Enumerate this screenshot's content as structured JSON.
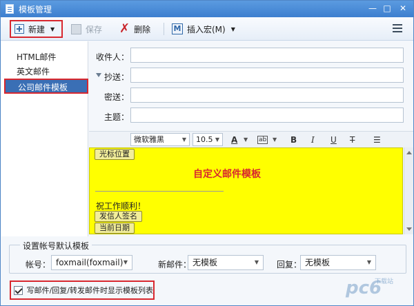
{
  "window": {
    "title": "模板管理",
    "min": "—",
    "max": "□",
    "close": "✕"
  },
  "toolbar": {
    "new_label": "新建",
    "save_label": "保存",
    "delete_label": "删除",
    "macro_label": "插入宏(M)",
    "macro_icon_letter": "M",
    "delete_icon_glyph": "✗"
  },
  "sidebar": {
    "items": [
      {
        "label": "HTML邮件"
      },
      {
        "label": "英文邮件"
      },
      {
        "label": "公司邮件模板"
      }
    ]
  },
  "form": {
    "to_label": "收件人：",
    "cc_label": "抄送：",
    "bcc_label": "密送：",
    "subject_label": "主题："
  },
  "format": {
    "font": "微软雅黑",
    "size": "10.5",
    "font_color": "A",
    "highlight": "ab",
    "bold": "B",
    "italic": "I",
    "underline": "U",
    "strike": "T",
    "list": "☰"
  },
  "editor": {
    "cursor_chip": "光标位置",
    "title": "自定义邮件模板",
    "greeting": "祝工作顺利！",
    "sender_chip": "发信人签名",
    "date_chip": "当前日期",
    "background_color": "#ffff00",
    "title_color": "#d8272e"
  },
  "defaults": {
    "group_title": "设置帐号默认模板",
    "account_label": "帐号：",
    "account_value": "foxmail(foxmail)",
    "new_mail_label": "新邮件：",
    "new_mail_value": "无模板",
    "reply_label": "回复：",
    "reply_value": "无模板"
  },
  "bottom": {
    "show_list_label": "写邮件/回复/转发邮件时显示模板列表",
    "checked": true
  },
  "watermark": {
    "text": "pc6",
    "sub": "下载站"
  },
  "colors": {
    "accent": "#3d7fcf",
    "highlight_border": "#d8272e",
    "selected_bg": "#3a6fb5"
  }
}
